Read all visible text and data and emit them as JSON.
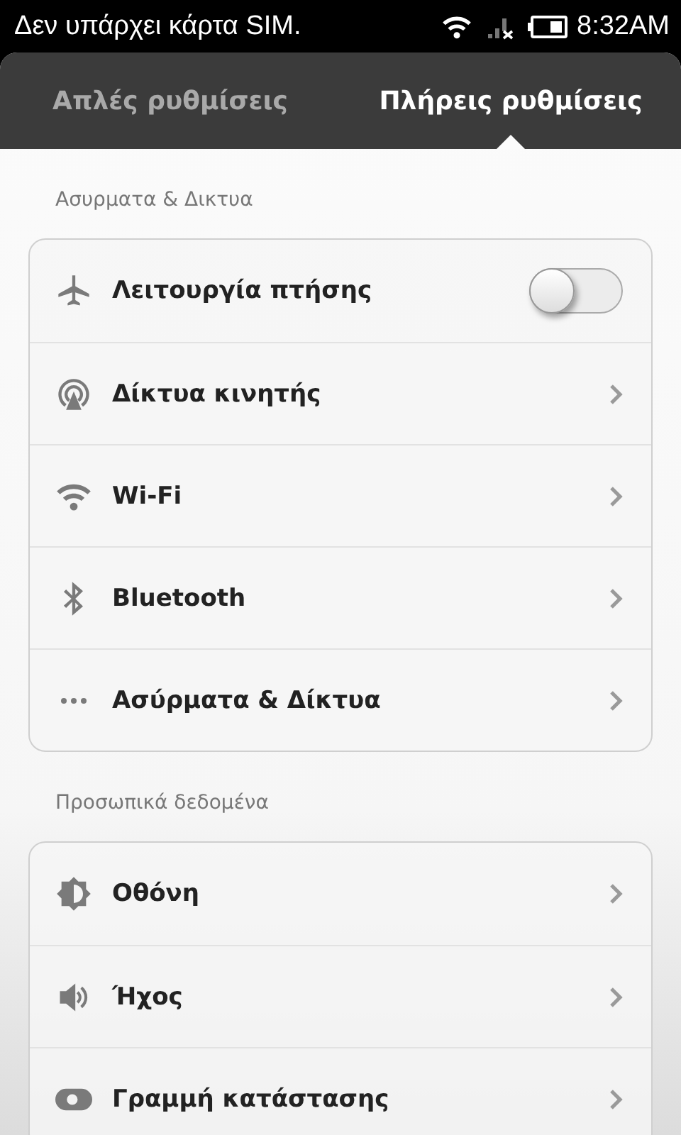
{
  "status_bar": {
    "carrier": "Δεν υπάρχει κάρτα SIM.",
    "time": "8:32AM"
  },
  "tabs": [
    {
      "label": "Απλές ρυθμίσεις",
      "selected": false
    },
    {
      "label": "Πλήρεις ρυθμίσεις",
      "selected": true
    }
  ],
  "sections": [
    {
      "title": "Ασυρματα & Δικτυα",
      "items": [
        {
          "label": "Λειτουργία πτήσης",
          "kind": "toggle",
          "on": false
        },
        {
          "label": "Δίκτυα κινητής",
          "kind": "link"
        },
        {
          "label": "Wi-Fi",
          "kind": "link"
        },
        {
          "label": "Bluetooth",
          "kind": "link"
        },
        {
          "label": "Ασύρματα & Δίκτυα",
          "kind": "link"
        }
      ]
    },
    {
      "title": "Προσωπικά δεδομένα",
      "items": [
        {
          "label": "Οθόνη",
          "kind": "link"
        },
        {
          "label": "Ήχος",
          "kind": "link"
        },
        {
          "label": "Γραμμή κατάστασης",
          "kind": "link"
        }
      ]
    }
  ]
}
